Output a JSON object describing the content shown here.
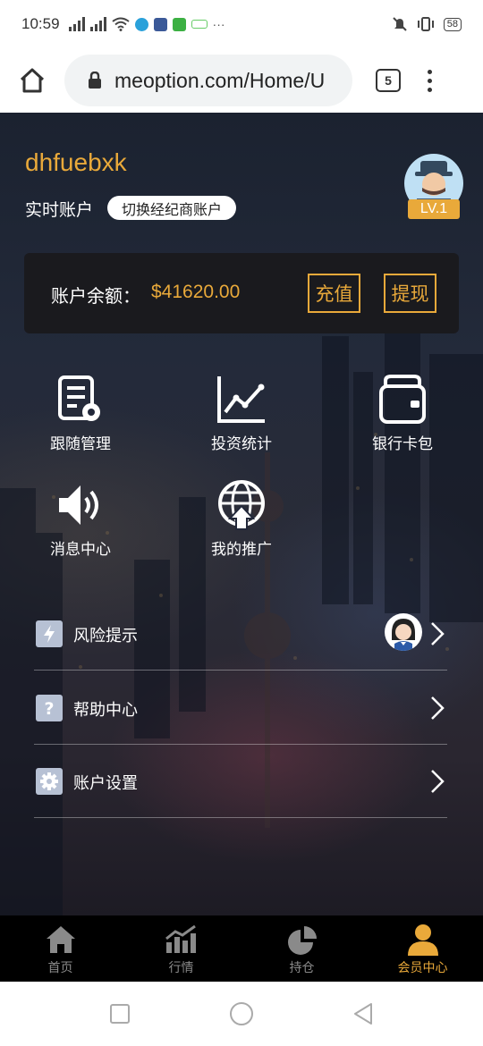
{
  "status_bar": {
    "time": "10:59",
    "battery": "58"
  },
  "browser": {
    "url": "meoption.com/Home/U",
    "tab_count": "5"
  },
  "profile": {
    "username": "dhfuebxk",
    "account_type": "实时账户",
    "switch_label": "切换经纪商账户",
    "level": "LV.1"
  },
  "balance": {
    "label": "账户余额：",
    "amount": "$41620.00",
    "deposit_label": "充值",
    "withdraw_label": "提现"
  },
  "grid": [
    {
      "label": "跟随管理",
      "icon": "follow-manage-icon"
    },
    {
      "label": "投资统计",
      "icon": "stats-chart-icon"
    },
    {
      "label": "银行卡包",
      "icon": "wallet-icon"
    },
    {
      "label": "消息中心",
      "icon": "speaker-icon"
    },
    {
      "label": "我的推广",
      "icon": "globe-upload-icon"
    }
  ],
  "menu": [
    {
      "label": "风险提示",
      "icon": "lightning-icon"
    },
    {
      "label": "帮助中心",
      "icon": "question-icon"
    },
    {
      "label": "账户设置",
      "icon": "gear-icon"
    }
  ],
  "tabs": [
    {
      "label": "首页",
      "icon": "home-icon",
      "active": false
    },
    {
      "label": "行情",
      "icon": "market-chart-icon",
      "active": false
    },
    {
      "label": "持仓",
      "icon": "pie-icon",
      "active": false
    },
    {
      "label": "会员中心",
      "icon": "user-icon",
      "active": true
    }
  ],
  "colors": {
    "accent": "#e9a93a",
    "card_bg": "#1a1a1e",
    "tabbar_bg": "#000000"
  }
}
